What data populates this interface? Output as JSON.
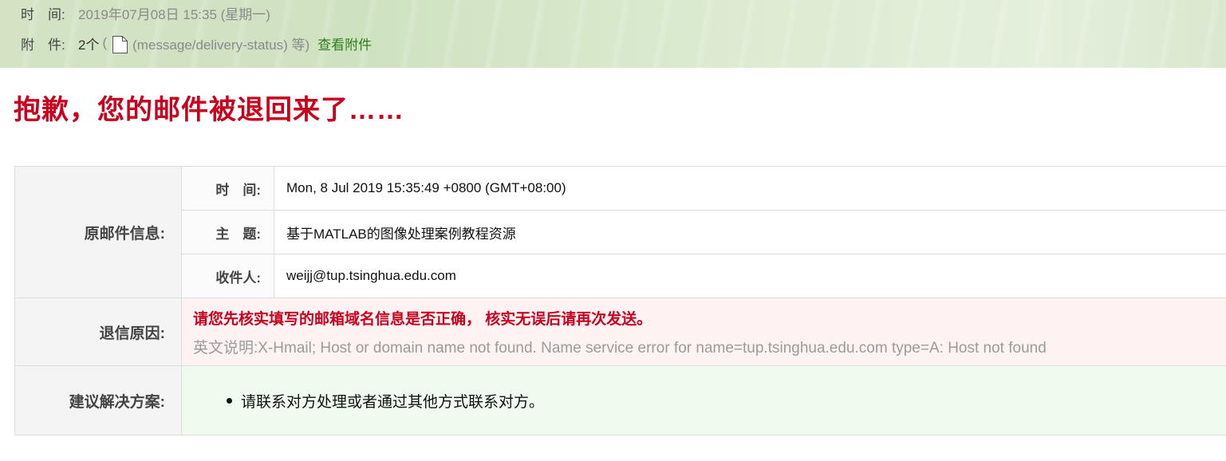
{
  "header": {
    "time_label": "时　间:",
    "time_value": "2019年07月08日 15:35 (星期一)",
    "attach_label": "附　件:",
    "attach_count": "2个",
    "attach_open": "(",
    "attach_type": "(message/delivery-status) 等)",
    "attach_link": "查看附件",
    "icons": {
      "attachment": "document-icon"
    }
  },
  "title": "抱歉，您的邮件被退回来了……",
  "original_mail": {
    "group_label": "原邮件信息:",
    "time_label": "时　间:",
    "time_value": "Mon, 8 Jul 2019 15:35:49 +0800 (GMT+08:00)",
    "subject_label": "主　题:",
    "subject_value": "基于MATLAB的图像处理案例教程资源",
    "recipient_label": "收件人:",
    "recipient_value": "weijj@tup.tsinghua.edu.com"
  },
  "bounce_reason": {
    "label": "退信原因:",
    "main": "请您先核实填写的邮箱域名信息是否正确，  核实无误后请再次发送。",
    "english": "英文说明:X-Hmail; Host or domain name not found. Name service error for name=tup.tsinghua.edu.com type=A: Host not found"
  },
  "suggestion": {
    "label": "建议解决方案:",
    "items": [
      "请联系对方处理或者通过其他方式联系对方。"
    ]
  },
  "colors": {
    "title_red": "#c8001e",
    "link_green": "#2e7d1f",
    "reason_bg": "#fff2f3",
    "suggest_bg": "#f0fbef"
  }
}
